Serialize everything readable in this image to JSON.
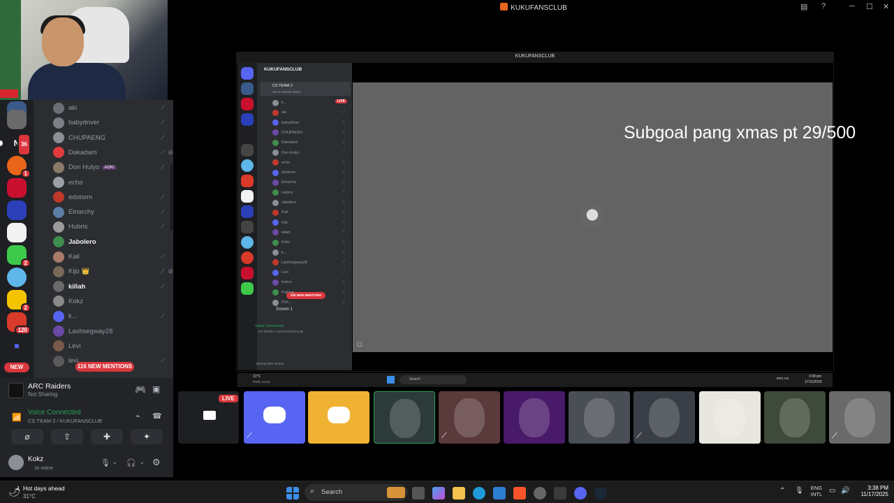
{
  "window": {
    "title": "KUKUFANSCLUB",
    "controls": [
      "─",
      "☐",
      "✕"
    ]
  },
  "rail": {
    "badges": [
      "36",
      "1",
      "2",
      "2",
      "120"
    ],
    "new_label": "NEW"
  },
  "members": [
    {
      "name": "aki",
      "color": "#6b6f76",
      "bold": false,
      "tag": "",
      "mic": true,
      "deaf": false
    },
    {
      "name": "babydriver",
      "color": "#7a7f88",
      "bold": false,
      "tag": "",
      "mic": true,
      "deaf": false
    },
    {
      "name": "CHUPAENG",
      "color": "#8b8f96",
      "bold": false,
      "tag": "",
      "mic": true,
      "deaf": false
    },
    {
      "name": "Dakadam",
      "color": "#e03c3c",
      "bold": false,
      "tag": "",
      "mic": true,
      "deaf": true
    },
    {
      "name": "Don Hulyo",
      "color": "#8a7a6a",
      "bold": false,
      "tag": "AOKI",
      "mic": true,
      "deaf": false
    },
    {
      "name": "echo",
      "color": "#9aa0a6",
      "bold": false,
      "tag": "",
      "mic": false,
      "deaf": false
    },
    {
      "name": "edstorm",
      "color": "#c0392b",
      "bold": false,
      "tag": "",
      "mic": true,
      "deaf": false
    },
    {
      "name": "Einarchy",
      "color": "#5b7fa6",
      "bold": false,
      "tag": "",
      "mic": true,
      "deaf": false
    },
    {
      "name": "Hubris",
      "color": "#9b9b9b",
      "bold": false,
      "tag": "",
      "mic": true,
      "deaf": false
    },
    {
      "name": "Jabolero",
      "color": "#3e8e4e",
      "bold": true,
      "tag": "",
      "mic": false,
      "deaf": false
    },
    {
      "name": "Kail",
      "color": "#a87a6a",
      "bold": false,
      "tag": "",
      "mic": true,
      "deaf": false
    },
    {
      "name": "Kijo 👑",
      "color": "#7a6a5a",
      "bold": false,
      "tag": "",
      "mic": true,
      "deaf": true
    },
    {
      "name": "killah",
      "color": "#6a6a6a",
      "bold": true,
      "tag": "",
      "mic": true,
      "deaf": false
    },
    {
      "name": "Kokz",
      "color": "#8a8a8a",
      "bold": false,
      "tag": "",
      "mic": false,
      "deaf": false
    },
    {
      "name": "k...",
      "color": "#5865f2",
      "bold": false,
      "tag": "",
      "mic": true,
      "deaf": false
    },
    {
      "name": "Lashsegway28",
      "color": "#6b4aa6",
      "bold": false,
      "tag": "",
      "mic": false,
      "deaf": false
    },
    {
      "name": "Levi",
      "color": "#7a5a4a",
      "bold": false,
      "tag": "",
      "mic": false,
      "deaf": false
    },
    {
      "name": "levi...",
      "color": "#5a5a5a",
      "bold": false,
      "tag": "",
      "mic": true,
      "deaf": false
    }
  ],
  "mentions_label": "116 NEW MENTIONS",
  "activity": {
    "name": "ARC Raiders",
    "status": "Not Sharing"
  },
  "voice": {
    "status": "Voice Connected",
    "channel": "CS TEAM 2 / KUKUFANSCLUB"
  },
  "user": {
    "name": "Kokz",
    "status": "In voice"
  },
  "inner": {
    "title": "KUKUFANSCLUB",
    "server": "KUKUFANSCLUB",
    "channel": "CS TEAM 2",
    "channel_sub": "Set a channel status",
    "live": "LIVE",
    "members": [
      "k...",
      "aki",
      "babydriver",
      "CHUPAENG",
      "Dakadam",
      "Don Hulyo",
      "echo",
      "edstorm",
      "Einarchy",
      "Hubris",
      "Jabolero",
      "Kail",
      "Kijo",
      "killah",
      "Kokz",
      "k...",
      "Lashsegway28",
      "Levi",
      "lewics",
      "PalDog",
      "Poh..."
    ],
    "mentions": "325 NEW MENTIONS",
    "screen": "Screen 1",
    "voice_status": "Voice Connected",
    "voice_channel": "CS TEAM 2 / KUKUFANSCLUB",
    "user_status": "Sharing their screen",
    "weather_temp": "31°C",
    "weather": "Partly sunny",
    "search": "Search",
    "time": "3:38 pm",
    "date": "17/11/2025",
    "lang": "ENG US"
  },
  "stream_overlay": "Subgoal pang xmas pt  29/500",
  "live_badge": "LIVE",
  "tiles": [
    {
      "kind": "screen",
      "color": "#1e1f22",
      "muted": false
    },
    {
      "kind": "discord",
      "color": "#5865f2",
      "muted": true
    },
    {
      "kind": "discord",
      "color": "#f0b232",
      "muted": false
    },
    {
      "kind": "photo",
      "color": "#2d3a3a",
      "muted": false
    },
    {
      "kind": "photo",
      "color": "#5a3a3a",
      "muted": true
    },
    {
      "kind": "photo",
      "color": "#4a1a6a",
      "muted": false
    },
    {
      "kind": "photo",
      "color": "#4a4e55",
      "muted": false
    },
    {
      "kind": "photo",
      "color": "#3a3f47",
      "muted": true
    },
    {
      "kind": "photo",
      "color": "#e8e6e0",
      "muted": false
    },
    {
      "kind": "photo",
      "color": "#3e4a3a",
      "muted": false
    },
    {
      "kind": "photo",
      "color": "#6a6a6a",
      "muted": true
    }
  ],
  "taskbar": {
    "weather_title": "Hot days ahead",
    "weather_temp": "31°C",
    "search": "Search",
    "lang": "ENG",
    "layout": "INTL",
    "time": "3:38 PM",
    "date": "11/17/2025"
  }
}
